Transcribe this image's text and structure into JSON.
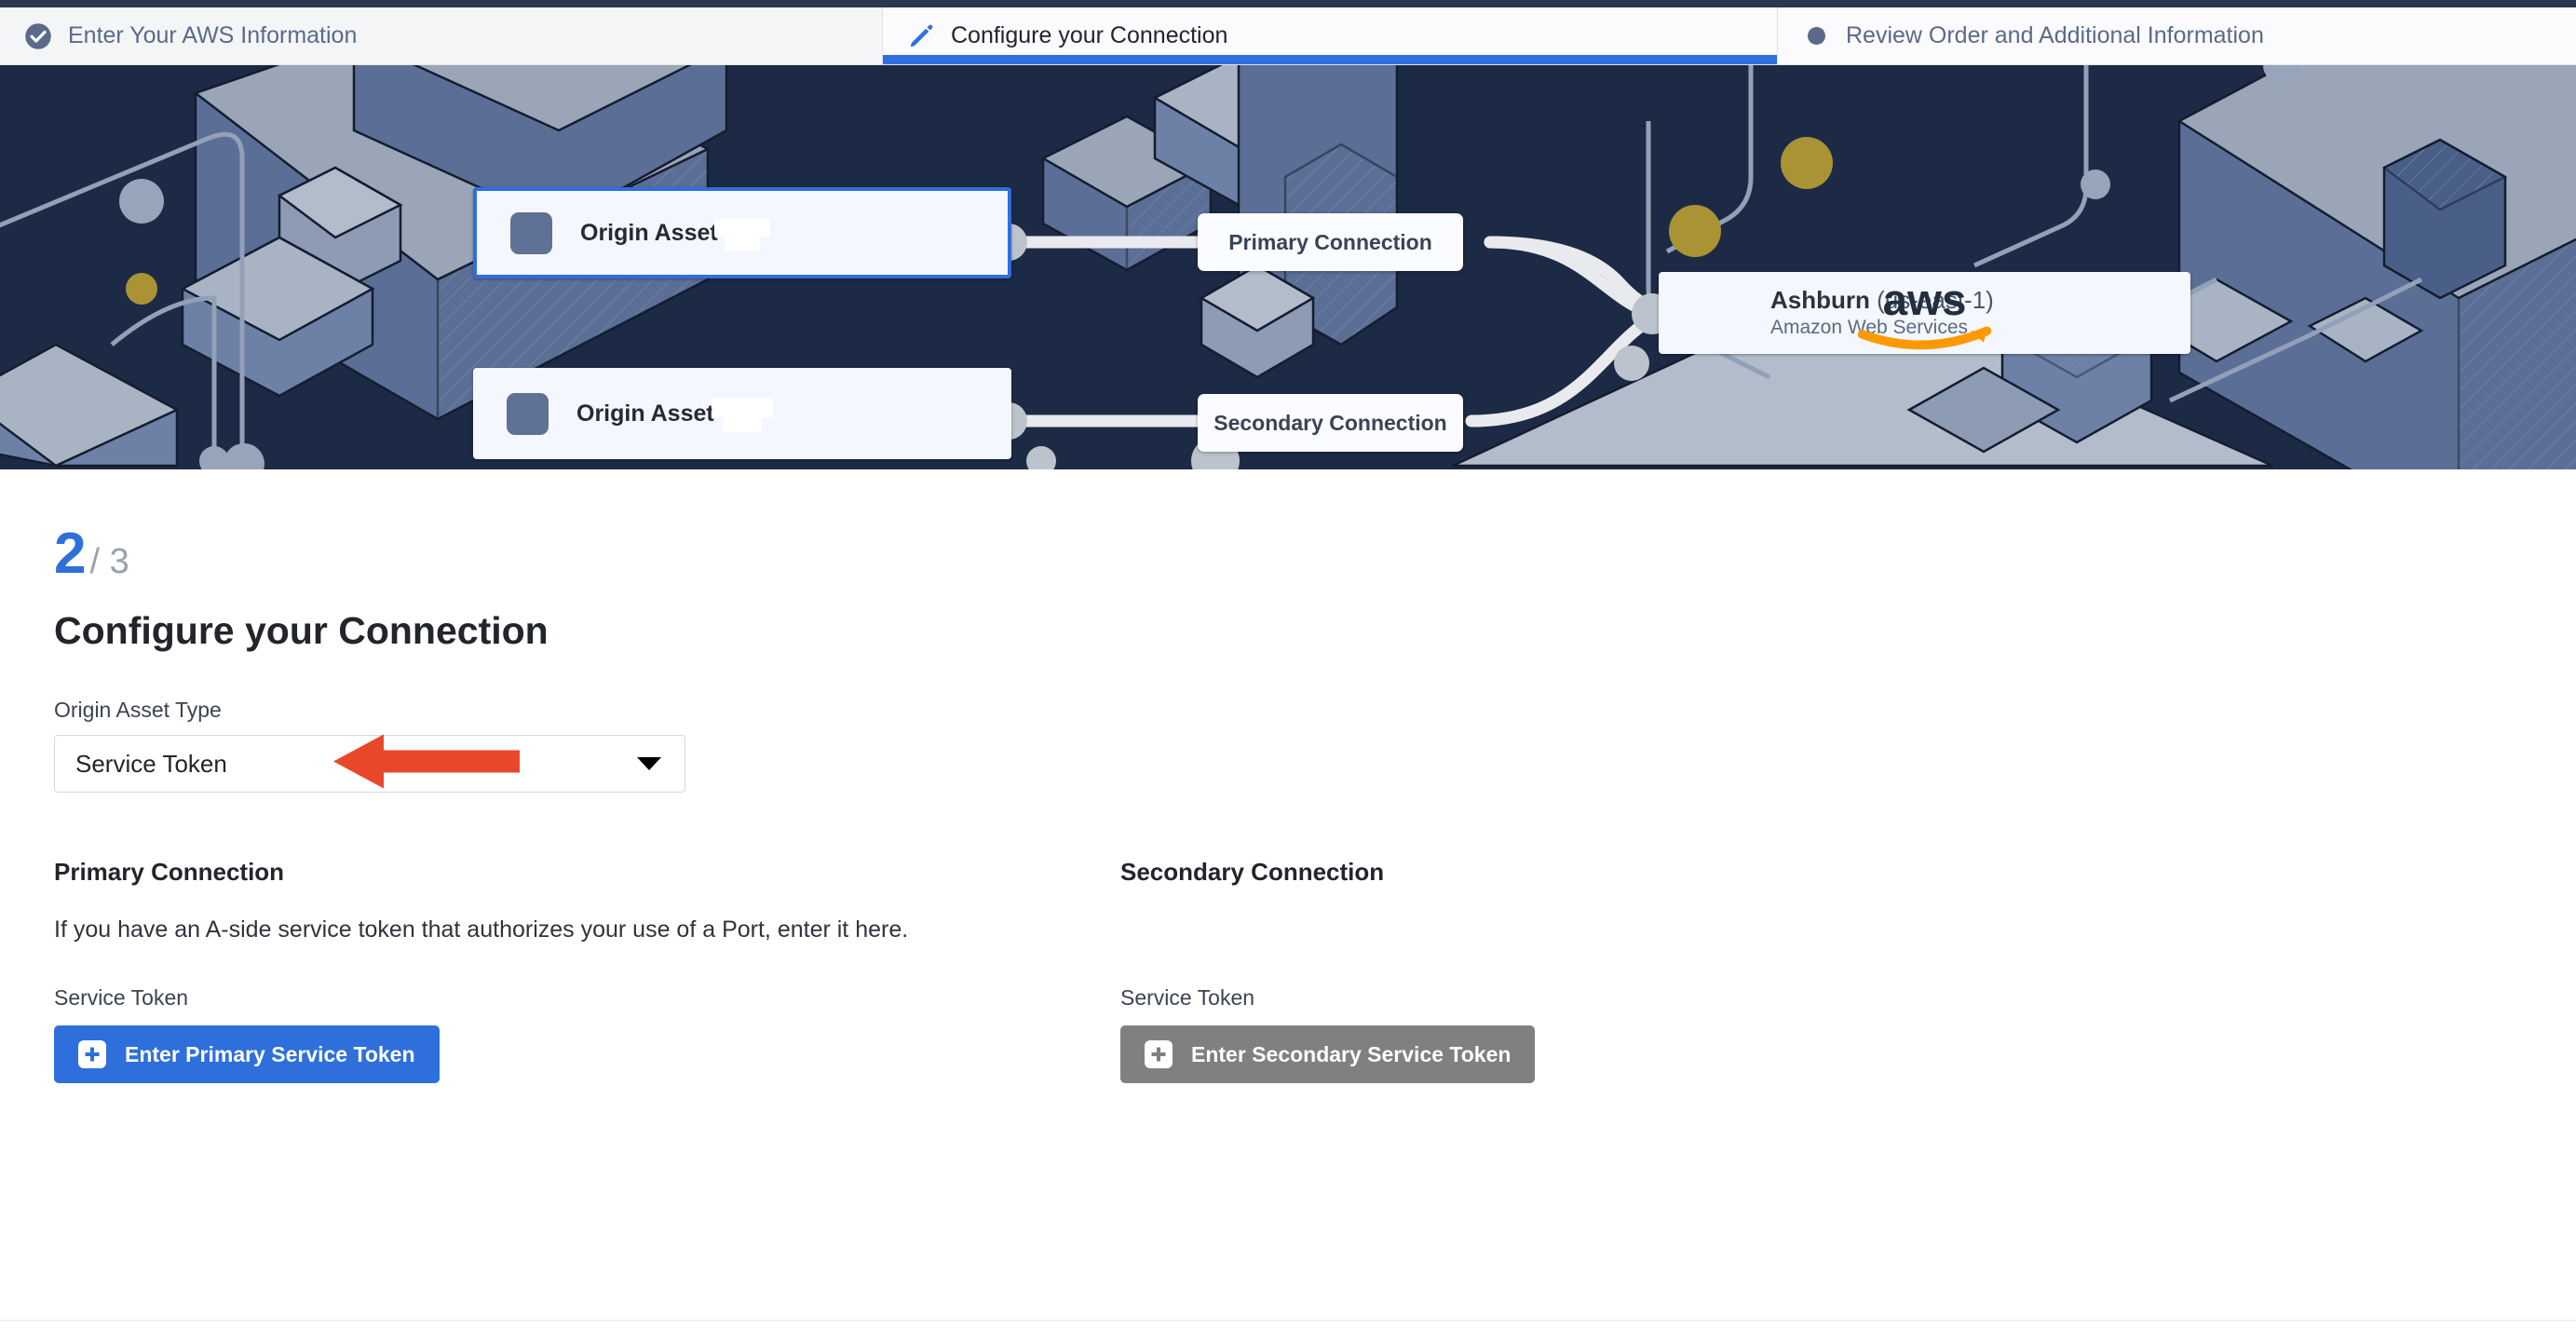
{
  "stepper": {
    "tabs": [
      {
        "label": "Enter Your AWS Information",
        "icon": "check-circle-icon",
        "state": "completed"
      },
      {
        "label": "Configure your Connection",
        "icon": "pencil-icon",
        "state": "active"
      },
      {
        "label": "Review Order and Additional Information",
        "icon": "dot-icon",
        "state": "upcoming"
      }
    ]
  },
  "hero": {
    "origin_assets": [
      {
        "label": "Origin Asset",
        "icon": "port-icon",
        "selected": true
      },
      {
        "label": "Origin Asset",
        "icon": "port-icon",
        "selected": false
      }
    ],
    "connections": [
      {
        "label": "Primary Connection"
      },
      {
        "label": "Secondary Connection"
      }
    ],
    "destination": {
      "logo": "aws-logo",
      "region_name": "Ashburn",
      "region_code": "(us-east-1)",
      "provider": "Amazon Web Services"
    }
  },
  "main": {
    "step_number": "2",
    "step_total": "/ 3",
    "title": "Configure your Connection",
    "origin_asset_type": {
      "label": "Origin Asset Type",
      "value": "Service Token",
      "options": [
        "Service Token"
      ]
    },
    "primary": {
      "title": "Primary Connection",
      "description": "If you have an A-side service token that authorizes your use of a Port, enter it here.",
      "token_label": "Service Token",
      "button_label": "Enter Primary Service Token",
      "button_icon": "plus-icon"
    },
    "secondary": {
      "title": "Secondary Connection",
      "description": "",
      "token_label": "Service Token",
      "button_label": "Enter Secondary Service Token",
      "button_icon": "plus-icon"
    }
  },
  "annotation": {
    "arrow": "red-left-arrow",
    "color": "#e8472a"
  },
  "colors": {
    "accent_blue": "#2f6fdc",
    "hero_background": "#1d2a45",
    "disabled_gray": "#808080",
    "annotation_red": "#e8472a"
  }
}
